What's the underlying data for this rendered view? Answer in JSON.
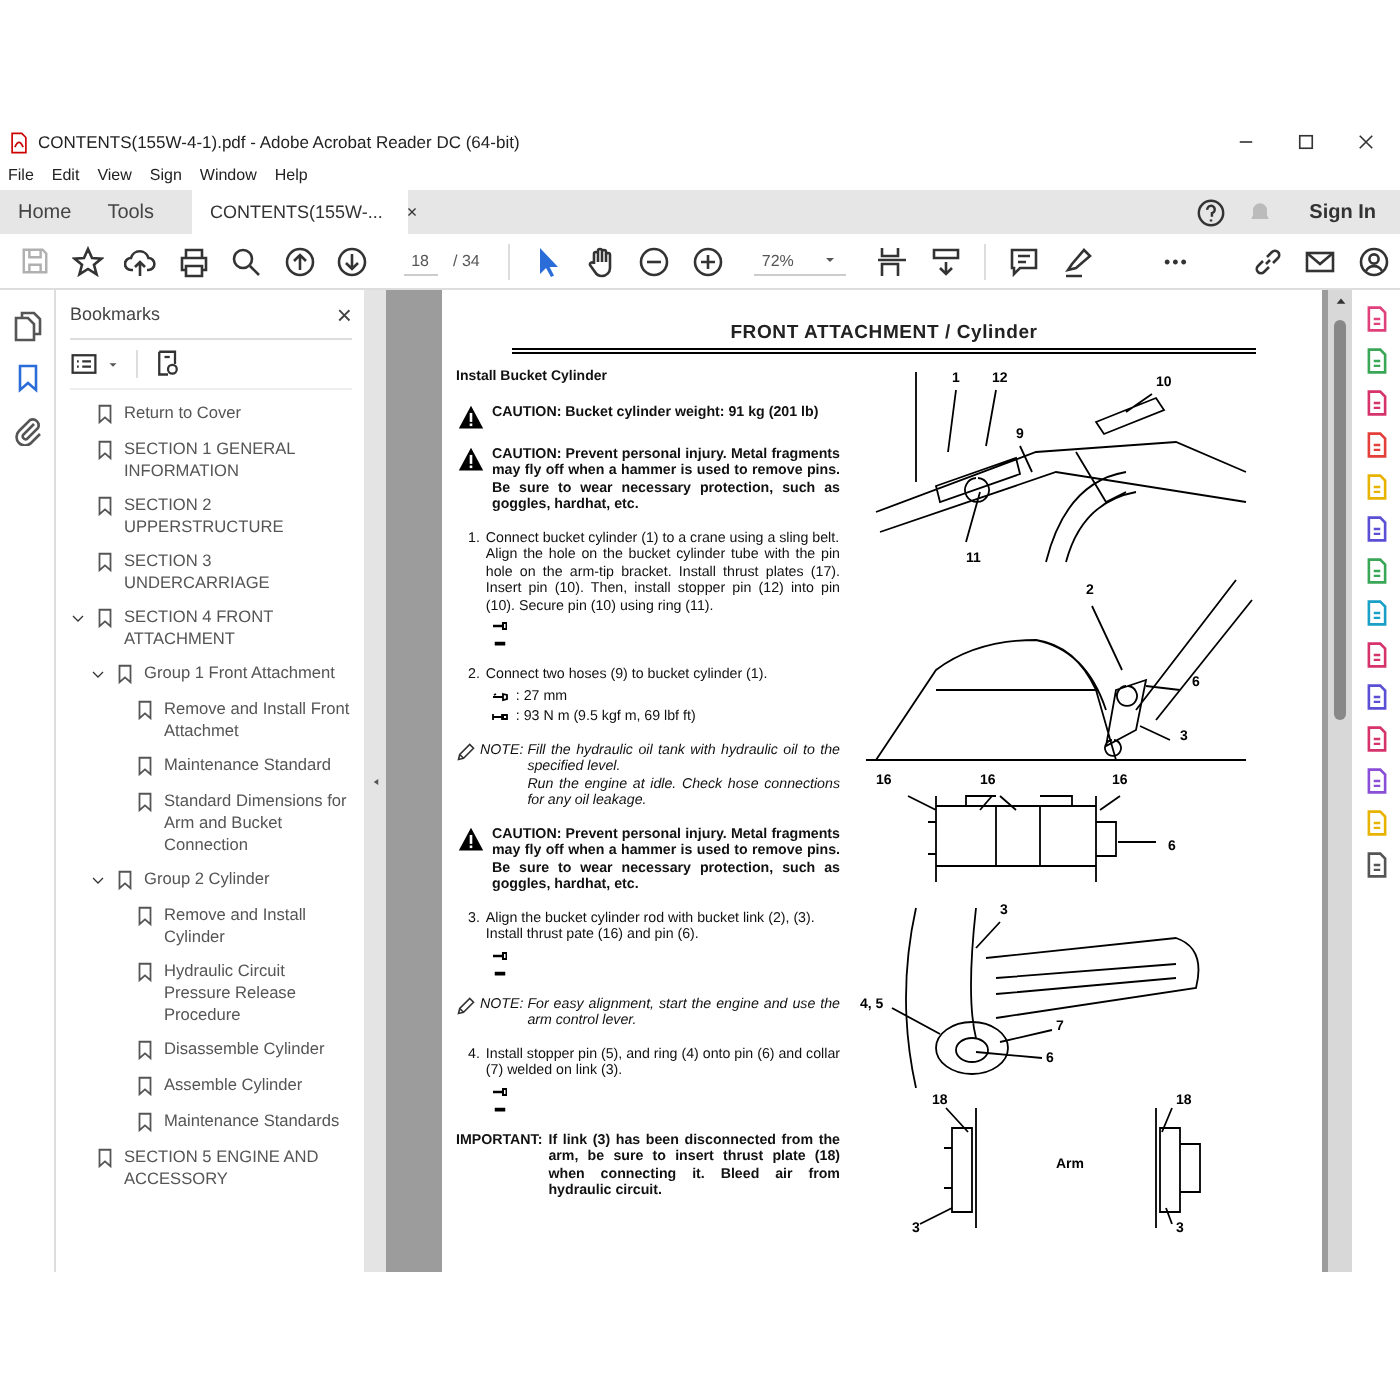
{
  "window": {
    "title": "CONTENTS(155W-4-1).pdf - Adobe Acrobat Reader DC (64-bit)"
  },
  "menu": [
    "File",
    "Edit",
    "View",
    "Sign",
    "Window",
    "Help"
  ],
  "tabs": [
    {
      "label": "Home",
      "kind": "nav",
      "selected": false
    },
    {
      "label": "Tools",
      "kind": "nav",
      "selected": false
    },
    {
      "label": "CONTENTS(155W-...",
      "kind": "document",
      "close": "×",
      "selected": true
    }
  ],
  "sign_in": "Sign In",
  "toolbar": {
    "save_disabled": true,
    "page": "18",
    "page_total": "/ 34",
    "zoom": "72%",
    "more": "•••"
  },
  "side_rail": [
    {
      "kind": "pages",
      "selected": false
    },
    {
      "kind": "bookmarks",
      "selected": true
    },
    {
      "kind": "attachments",
      "selected": false
    }
  ],
  "bookmarks": {
    "title": "Bookmarks",
    "close": "×",
    "items": [
      {
        "label": "Return to Cover"
      },
      {
        "label": "SECTION 1 GENERAL INFORMATION"
      },
      {
        "label": "SECTION 2 UPPERSTRUCTURE"
      },
      {
        "label": "SECTION 3 UNDERCARRIAGE"
      },
      {
        "label": "SECTION 4 FRONT ATTACHMENT",
        "expanded": true,
        "children": [
          {
            "label": "Group 1 Front Attachment",
            "expanded": true,
            "children": [
              {
                "label": "Remove and Install Front Attachmet"
              },
              {
                "label": "Maintenance Standard"
              },
              {
                "label": "Standard Dimensions for Arm and Bucket Connection"
              }
            ]
          },
          {
            "label": "Group 2 Cylinder",
            "expanded": true,
            "children": [
              {
                "label": "Remove and Install Cylinder"
              },
              {
                "label": "Hydraulic Circuit Pressure Release Procedure"
              },
              {
                "label": "Disassemble Cylinder"
              },
              {
                "label": "Assemble Cylinder"
              },
              {
                "label": "Maintenance Standards"
              }
            ]
          }
        ]
      },
      {
        "label": "SECTION 5 ENGINE AND ACCESSORY"
      }
    ]
  },
  "document": {
    "header": "FRONT ATTACHMENT / Cylinder",
    "title": "Install Bucket Cylinder",
    "blocks": [
      {
        "kind": "caution",
        "text": "CAUTION:  Bucket cylinder weight: 91 kg (201 lb)"
      },
      {
        "kind": "caution",
        "text": "CAUTION: Prevent personal injury. Metal fragments may fly off when a hammer is used to remove pins. Be sure to wear necessary protection, such as goggles, hardhat, etc."
      },
      {
        "kind": "step",
        "number": "1.",
        "paragraphs": [
          "Connect bucket cylinder (1) to a crane using a sling belt.",
          "Align the hole on the bucket cylinder tube with the pin hole on the arm-tip bracket. Install thrust plates (17). Insert pin (10). Then, install stopper pin (12) into pin (10). Secure pin (10) using ring (11)."
        ],
        "tool_icons": true
      },
      {
        "kind": "step",
        "number": "2.",
        "paragraphs": [
          "Connect two hoses (9) to bucket cylinder (1)."
        ],
        "specs": [
          ": 27 mm",
          ": 93 N m (9.5 kgf m, 69 lbf ft)"
        ]
      },
      {
        "kind": "note",
        "label": "NOTE:",
        "paragraphs": [
          "Fill the hydraulic oil tank with hydraulic oil to the specified level.",
          "Run the engine at idle. Check hose connections for any oil leakage."
        ]
      },
      {
        "kind": "caution",
        "text": "CAUTION: Prevent personal injury. Metal fragments may fly off when a hammer is used to remove pins. Be sure to wear necessary protection, such as goggles, hardhat, etc."
      },
      {
        "kind": "step",
        "number": "3.",
        "paragraphs": [
          "Align the bucket cylinder rod with bucket link (2), (3).",
          "Install thrust pate (16) and pin (6)."
        ],
        "tool_icons": true
      },
      {
        "kind": "note",
        "label": "NOTE:",
        "paragraphs": [
          "For easy alignment, start the engine and use the arm control lever."
        ]
      },
      {
        "kind": "step",
        "number": "4.",
        "paragraphs": [
          "Install stopper pin (5), and ring (4) onto pin (6) and collar (7) welded on link (3)."
        ],
        "tool_icons": true
      },
      {
        "kind": "important",
        "label": "IMPORTANT:",
        "text": "If link (3) has been disconnected from the arm, be sure to insert thrust plate (18) when connecting it. Bleed air from hydraulic circuit."
      }
    ],
    "figures": [
      {
        "kind": "boom",
        "labels": [
          "1",
          "12",
          "10",
          "9",
          "11"
        ]
      },
      {
        "kind": "bucket",
        "labels": [
          "2",
          "6",
          "3"
        ]
      },
      {
        "kind": "plates",
        "labels": [
          "16",
          "16",
          "16",
          "6"
        ]
      },
      {
        "kind": "collar",
        "labels": [
          "3",
          "4, 5",
          "7",
          "6"
        ]
      },
      {
        "kind": "thrust",
        "labels": [
          "18",
          "18",
          "Arm",
          "3",
          "3"
        ]
      }
    ]
  }
}
